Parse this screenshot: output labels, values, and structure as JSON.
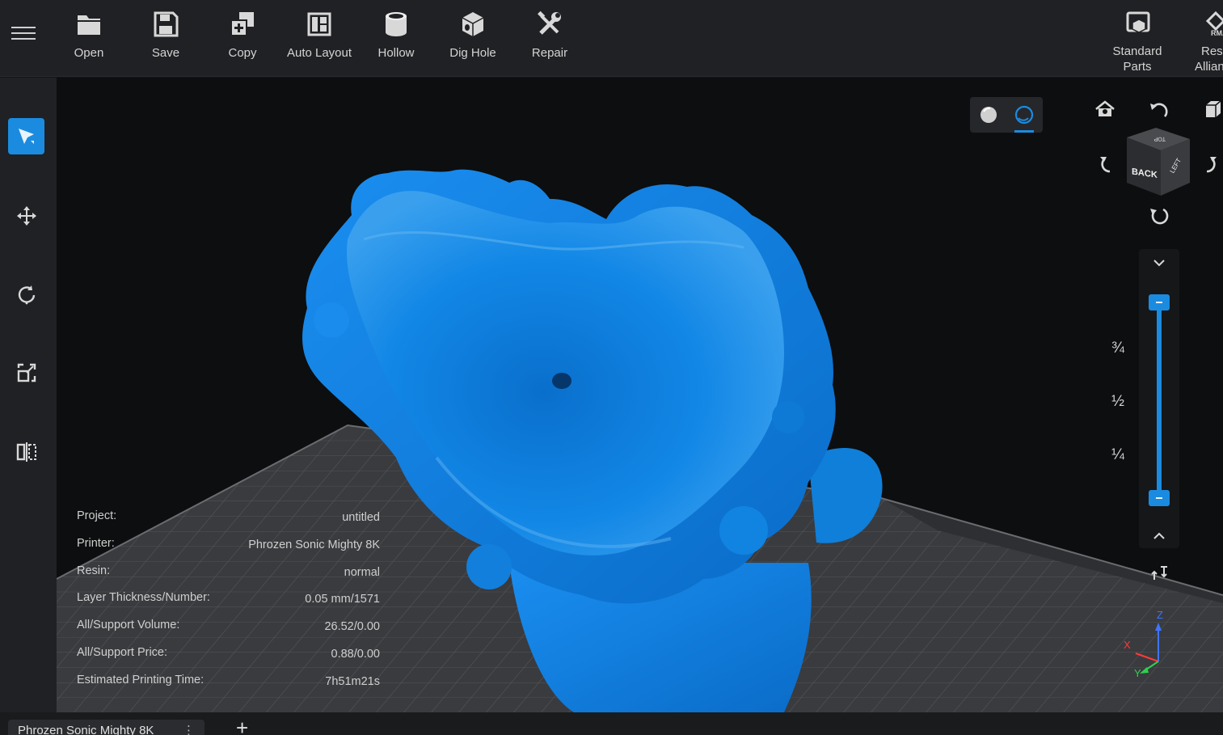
{
  "toolbar": {
    "items": [
      {
        "label": "Open",
        "icon": "folder-icon"
      },
      {
        "label": "Save",
        "icon": "save-icon"
      },
      {
        "label": "Copy",
        "icon": "copy-icon"
      },
      {
        "label": "Auto Layout",
        "icon": "auto-layout-icon"
      },
      {
        "label": "Hollow",
        "icon": "hollow-icon"
      },
      {
        "label": "Dig Hole",
        "icon": "dig-hole-icon"
      },
      {
        "label": "Repair",
        "icon": "repair-icon"
      }
    ],
    "standard_parts_line1": "Standard",
    "standard_parts_line2": "Parts",
    "resin_alliance_line1": "Resi",
    "resin_alliance_line2": "Allian",
    "resin_alliance_logo": "RMA"
  },
  "sidebar": {
    "items": [
      {
        "name": "select",
        "icon": "select-arrow-icon",
        "active": true
      },
      {
        "name": "move",
        "icon": "move-icon",
        "active": false
      },
      {
        "name": "rotate",
        "icon": "rotate-icon",
        "active": false
      },
      {
        "name": "scale",
        "icon": "scale-icon",
        "active": false
      },
      {
        "name": "mirror",
        "icon": "mirror-icon",
        "active": false
      }
    ]
  },
  "view_cube": {
    "front_face": "BACK",
    "side_face": "LEFT",
    "top_face": "TOP"
  },
  "slider": {
    "marks": [
      "¾",
      "½",
      "¼"
    ],
    "upper_value": 1.0,
    "lower_value": 0.0
  },
  "info": {
    "rows": [
      {
        "key": "Project:",
        "value": "untitled"
      },
      {
        "key": "Printer:",
        "value": "Phrozen Sonic Mighty 8K"
      },
      {
        "key": "Resin:",
        "value": "normal"
      },
      {
        "key": "Layer Thickness/Number:",
        "value": "0.05 mm/1571"
      },
      {
        "key": "All/Support Volume:",
        "value": "26.52/0.00"
      },
      {
        "key": "All/Support Price:",
        "value": "0.88/0.00"
      },
      {
        "key": "Estimated Printing Time:",
        "value": "7h51m21s"
      }
    ]
  },
  "axes": {
    "x": "X",
    "y": "Y",
    "z": "Z"
  },
  "bottom": {
    "printer_tab": "Phrozen Sonic Mighty 8K",
    "more": "⋮",
    "add": "+"
  },
  "colors": {
    "accent": "#1b8be0",
    "model": "#0f82e0",
    "toolbar_bg": "#202124",
    "viewport_bg": "#0d0e0f",
    "plate": "#3b3c3f"
  }
}
